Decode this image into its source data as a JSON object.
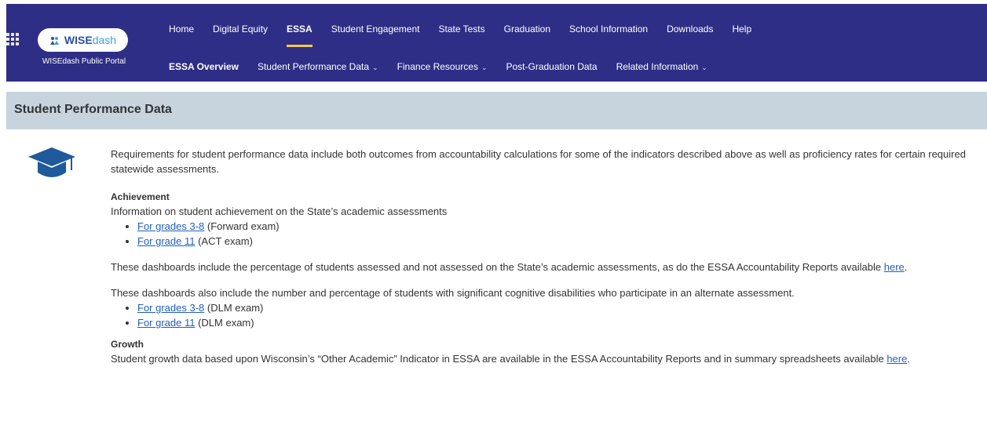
{
  "header": {
    "logo_text_ws": "WISE",
    "logo_text_dash": "dash",
    "portal_label": "WISEdash Public Portal",
    "nav_primary": [
      {
        "label": "Home"
      },
      {
        "label": "Digital Equity"
      },
      {
        "label": "ESSA",
        "active": true
      },
      {
        "label": "Student Engagement"
      },
      {
        "label": "State Tests"
      },
      {
        "label": "Graduation"
      },
      {
        "label": "School Information"
      },
      {
        "label": "Downloads"
      },
      {
        "label": "Help"
      }
    ],
    "nav_secondary": [
      {
        "label": "ESSA Overview",
        "active": true,
        "dropdown": false
      },
      {
        "label": "Student Performance Data",
        "dropdown": true
      },
      {
        "label": "Finance Resources",
        "dropdown": true
      },
      {
        "label": "Post-Graduation Data",
        "dropdown": false
      },
      {
        "label": "Related Information",
        "dropdown": true
      }
    ],
    "background_color": "#2e2e86",
    "active_underline_color": "#f2c94c"
  },
  "section": {
    "title": "Student Performance Data",
    "icon": "graduation-cap-icon",
    "bar_color": "#c8d4dd"
  },
  "content": {
    "intro": "Requirements for student performance data include both outcomes from accountability calculations for some of the indicators described above as well as proficiency rates for certain required statewide assessments.",
    "achievement": {
      "heading": "Achievement",
      "description": "Information on student achievement on the State’s academic assessments",
      "links": [
        {
          "link": "For grades 3-8",
          "suffix": " (Forward exam)"
        },
        {
          "link": "For grade 11",
          "suffix": " (ACT exam)"
        }
      ],
      "para_assessed_prefix": "These dashboards include the percentage of students assessed and not assessed on the State’s academic assessments, as do the ESSA Accountability Reports available ",
      "para_assessed_link": "here",
      "para_assessed_suffix": ".",
      "para_alternate": "These dashboards also include the number and percentage of students with significant cognitive disabilities who participate in an alternate assessment.",
      "alt_links": [
        {
          "link": "For grades 3-8",
          "suffix": " (DLM exam)"
        },
        {
          "link": "For grade 11",
          "suffix": " (DLM exam)"
        }
      ]
    },
    "growth": {
      "heading": "Growth",
      "text_prefix": "Student growth data based upon Wisconsin’s “Other Academic” Indicator in ESSA are available in the ESSA Accountability Reports and in summary spreadsheets available ",
      "link": "here",
      "text_suffix": "."
    },
    "link_color": "#1f5fbf"
  }
}
